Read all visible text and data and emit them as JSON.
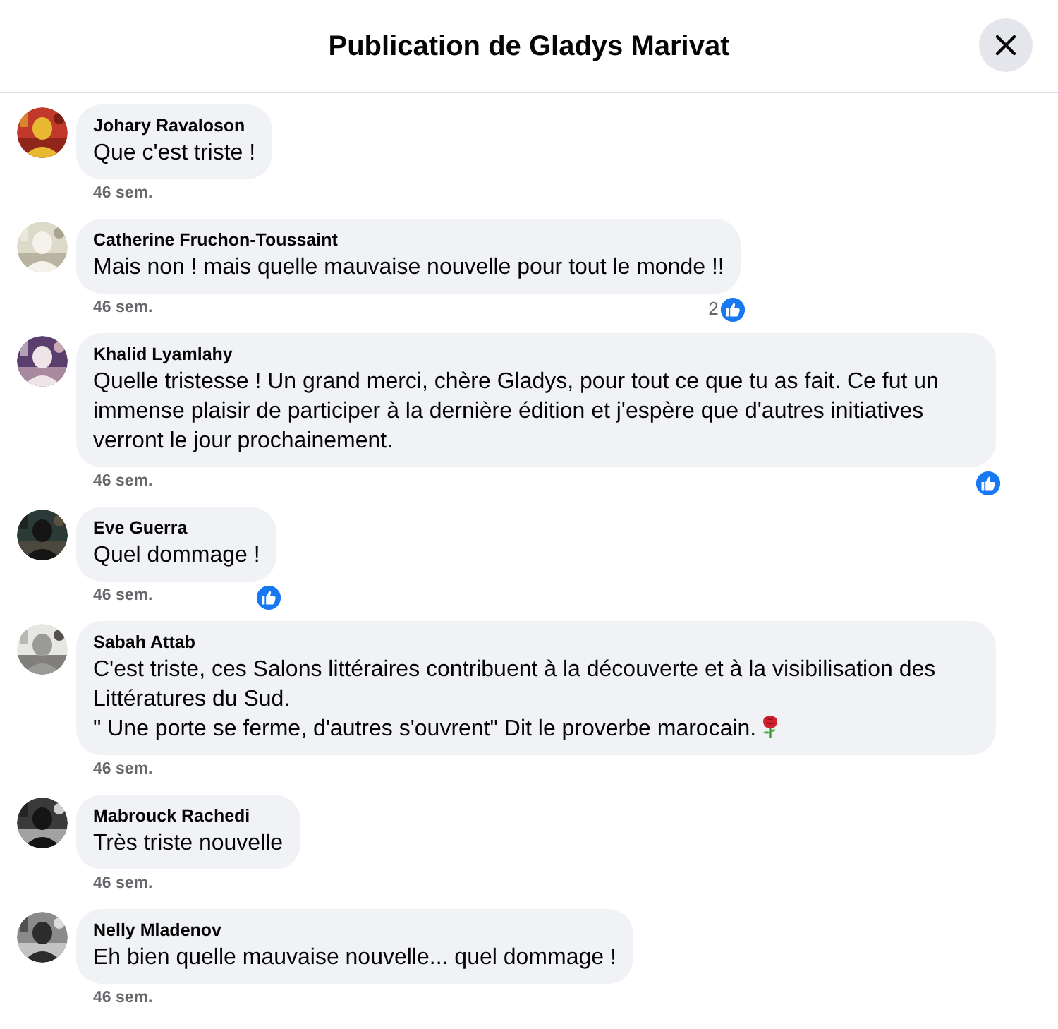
{
  "dialog": {
    "title": "Publication de Gladys Marivat"
  },
  "comments": [
    {
      "author": "Johary Ravaloson",
      "lines": [
        "Que c'est triste !"
      ],
      "time": "46 sem.",
      "liked": false
    },
    {
      "author": "Catherine Fruchon-Toussaint",
      "lines": [
        "Mais non ! mais quelle mauvaise nouvelle pour tout le monde !!"
      ],
      "time": "46 sem.",
      "liked": true,
      "like_count": "2"
    },
    {
      "author": "Khalid Lyamlahy",
      "lines": [
        "Quelle tristesse ! Un grand merci, chère Gladys, pour tout ce que tu as fait. Ce fut un immense plaisir de participer à la dernière édition et j'espère que d'autres initiatives verront le jour prochainement."
      ],
      "time": "46 sem.",
      "liked": true
    },
    {
      "author": "Eve Guerra",
      "lines": [
        "Quel dommage !"
      ],
      "time": "46 sem.",
      "liked": true
    },
    {
      "author": "Sabah Attab",
      "lines": [
        "C'est triste, ces Salons littéraires contribuent à la découverte et à la visibilisation des Littératures du Sud.",
        "\" Une porte se ferme, d'autres s'ouvrent\" Dit le proverbe marocain."
      ],
      "rose_emoji": true,
      "time": "46 sem.",
      "liked": false
    },
    {
      "author": "Mabrouck Rachedi",
      "lines": [
        "Très triste nouvelle"
      ],
      "time": "46 sem.",
      "liked": false
    },
    {
      "author": "Nelly Mladenov",
      "lines": [
        "Eh bien quelle mauvaise nouvelle... quel dommage !"
      ],
      "time": "46 sem.",
      "liked": false
    }
  ]
}
